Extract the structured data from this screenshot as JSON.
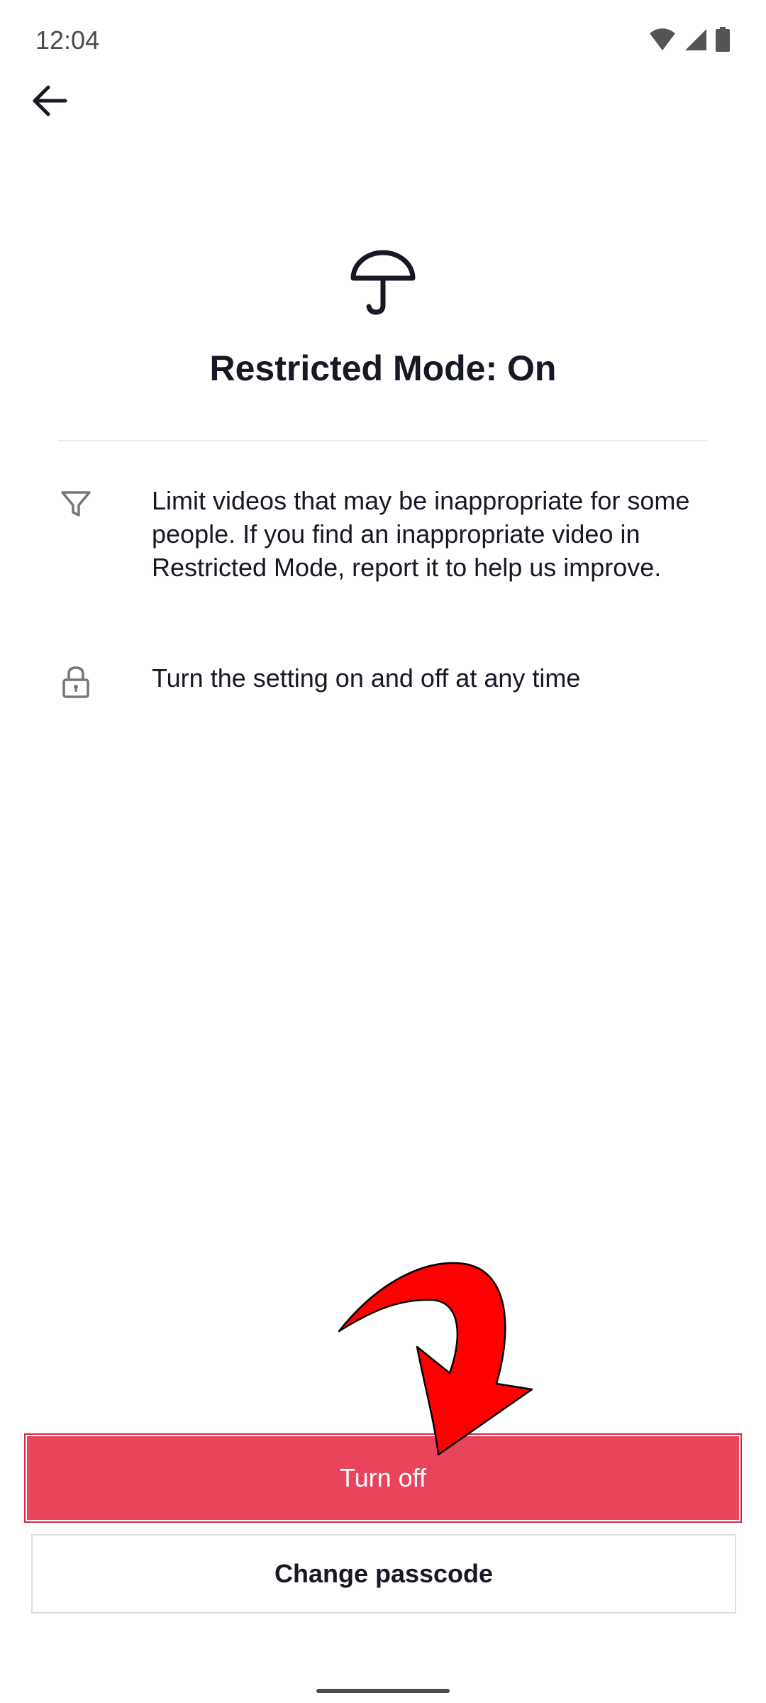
{
  "status_bar": {
    "time": "12:04",
    "icons": [
      "wifi-icon",
      "cellular-signal-icon",
      "battery-icon"
    ]
  },
  "header": {
    "back_icon": "arrow-left-icon"
  },
  "hero": {
    "icon": "umbrella-icon",
    "title": "Restricted Mode: On"
  },
  "info_items": [
    {
      "icon": "filter-icon",
      "text": "Limit videos that may be inappropriate for some people. If you find an inappropriate video in Restricted Mode, report it to help us improve."
    },
    {
      "icon": "lock-icon",
      "text": "Turn the setting on and off at any time"
    }
  ],
  "actions": {
    "turn_off_label": "Turn off",
    "change_passcode_label": "Change passcode"
  },
  "colors": {
    "primary": "#e8455c",
    "text": "#161823",
    "annotation": "#ff0000"
  }
}
